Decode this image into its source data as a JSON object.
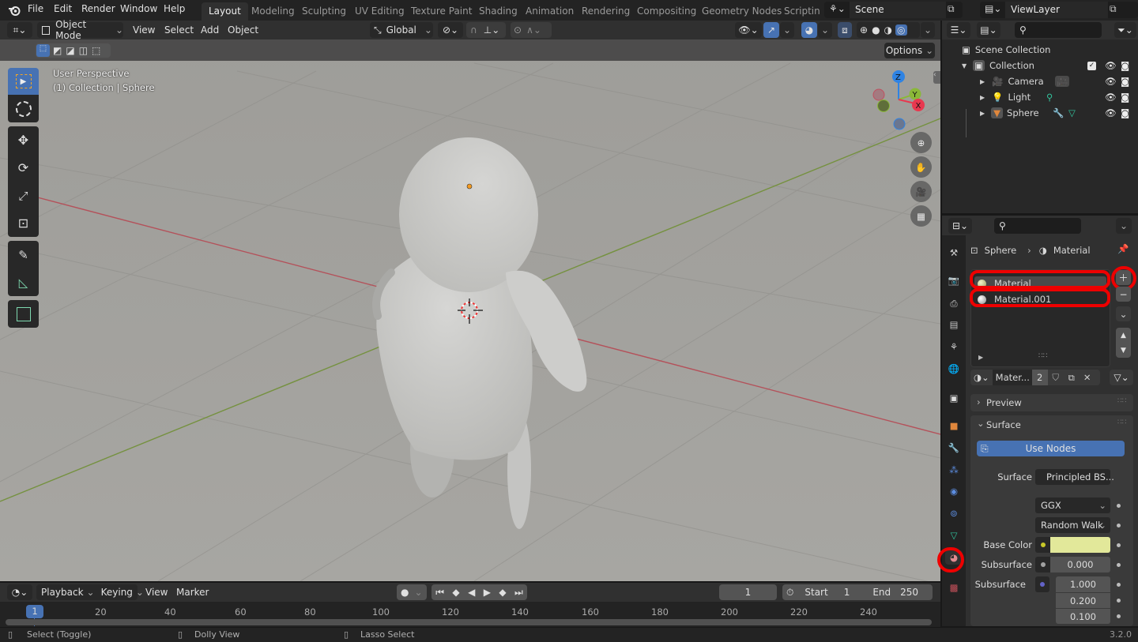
{
  "topbar": {
    "menu": [
      "File",
      "Edit",
      "Render",
      "Window",
      "Help"
    ],
    "workspaces": [
      "Layout",
      "Modeling",
      "Sculpting",
      "UV Editing",
      "Texture Paint",
      "Shading",
      "Animation",
      "Rendering",
      "Compositing",
      "Geometry Nodes",
      "Scripting"
    ],
    "active_workspace": "Layout",
    "scene": "Scene",
    "view_layer": "ViewLayer"
  },
  "viewport_header": {
    "mode": "Object Mode",
    "menus": [
      "View",
      "Select",
      "Add",
      "Object"
    ],
    "orientation": "Global",
    "options_label": "Options"
  },
  "viewport": {
    "perspective_label": "User Perspective",
    "collection_label": "(1) Collection | Sphere",
    "gizmo_axes": [
      "Z",
      "Y",
      "X"
    ],
    "colors": {
      "x_axis": "#e8384f",
      "y_axis": "#8ab838",
      "z_axis": "#2f83e3",
      "grid_red": "#b4515a",
      "grid_green": "#75913f"
    }
  },
  "outliner": {
    "root": "Scene Collection",
    "collection": "Collection",
    "items": [
      {
        "name": "Camera",
        "type": "camera"
      },
      {
        "name": "Light",
        "type": "light"
      },
      {
        "name": "Sphere",
        "type": "mesh"
      }
    ]
  },
  "properties": {
    "breadcrumb_object": "Sphere",
    "breadcrumb_data": "Material",
    "material_slots": [
      "Material",
      "Material.001"
    ],
    "material_name_short": "Mater...",
    "user_count": "2",
    "panels": {
      "preview": "Preview",
      "surface": "Surface"
    },
    "use_nodes_label": "Use Nodes",
    "surface_label": "Surface",
    "surface_value": "Principled BS...",
    "distribution": "GGX",
    "subsurface_method": "Random Walk",
    "base_color_label": "Base Color",
    "base_color": "#e2e89a",
    "subsurface_label": "Subsurface",
    "subsurface_value": "0.000",
    "subsurface_radius_label": "Subsurface",
    "subsurface_radius": [
      "1.000",
      "0.200",
      "0.100"
    ]
  },
  "timeline": {
    "menus": [
      "Playback",
      "Keying",
      "View",
      "Marker"
    ],
    "current_frame": "1",
    "start_label": "Start",
    "start": "1",
    "end_label": "End",
    "end": "250",
    "ruler": [
      "20",
      "40",
      "60",
      "80",
      "100",
      "120",
      "140",
      "160",
      "180",
      "200",
      "220",
      "240"
    ],
    "playhead": "1"
  },
  "statusbar": {
    "hints": [
      "Select (Toggle)",
      "Dolly View",
      "Lasso Select"
    ],
    "version": "3.2.0"
  }
}
